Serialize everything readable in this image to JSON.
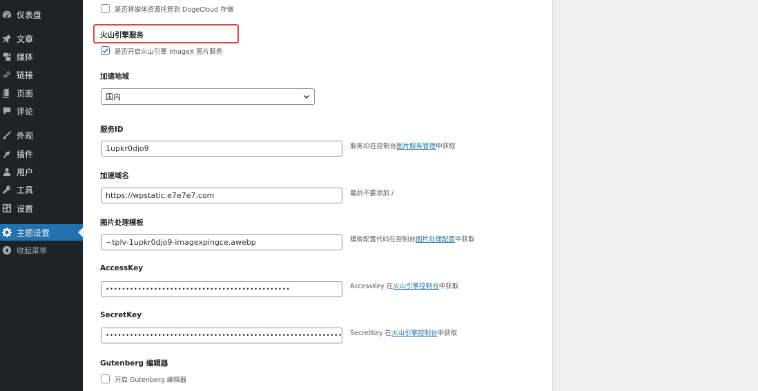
{
  "sidebar": {
    "items": [
      {
        "label": "仪表盘",
        "icon": "dashboard-icon"
      },
      {
        "label": "文章",
        "icon": "pin-icon"
      },
      {
        "label": "媒体",
        "icon": "media-icon"
      },
      {
        "label": "链接",
        "icon": "link-icon"
      },
      {
        "label": "页面",
        "icon": "page-icon"
      },
      {
        "label": "评论",
        "icon": "comment-icon"
      },
      {
        "label": "外观",
        "icon": "brush-icon"
      },
      {
        "label": "插件",
        "icon": "plugin-icon"
      },
      {
        "label": "用户",
        "icon": "user-icon"
      },
      {
        "label": "工具",
        "icon": "wrench-icon"
      },
      {
        "label": "设置",
        "icon": "settings-icon"
      },
      {
        "label": "主题设置",
        "icon": "gear-icon",
        "active": true
      },
      {
        "label": "收起菜单",
        "icon": "collapse-icon"
      }
    ]
  },
  "form": {
    "dogecloud": {
      "label": "是否将媒体资源托管到 DogeCloud 存储",
      "checked": false
    },
    "volcano_title": "火山引擎服务",
    "imagex": {
      "label": "是否开启火山引擎 ImageX 图片服务",
      "checked": true
    },
    "region": {
      "label": "加速地域",
      "value": "国内"
    },
    "service_id": {
      "label": "服务ID",
      "value": "1upkr0djo9",
      "desc_pre": "服务ID在控制台",
      "desc_link": "图片服务管理",
      "desc_post": "中获取"
    },
    "domain": {
      "label": "加速域名",
      "value": "https://wpstatic.e7e7e7.com",
      "desc": "最后不要添加 /"
    },
    "template": {
      "label": "图片处理模板",
      "value": "~tplv-1upkr0djo9-imagexpingce.awebp",
      "desc_pre": "模板配置代码在控制台",
      "desc_link": "图片处理配置",
      "desc_post": "中获取"
    },
    "access_key": {
      "label": "AccessKey",
      "value": "••••••••••••••••••••••••••••••••••••••••••••••",
      "desc_pre": "AccessKey 在",
      "desc_link": "火山引擎控制台",
      "desc_post": "中获取"
    },
    "secret_key": {
      "label": "SecretKey",
      "value": "•••••••••••••••••••••••••••••••••••••••••••••••••••••••••••••",
      "desc_pre": "SecretKey 在",
      "desc_link": "火山引擎控制台",
      "desc_post": "中获取"
    },
    "gutenberg": {
      "title": "Gutenberg 编辑器",
      "label": "开启 Gutenberg 编辑器",
      "checked": false
    }
  },
  "colors": {
    "accent": "#2271b1",
    "highlight": "#d94b3a",
    "sidebar": "#1d2327"
  }
}
